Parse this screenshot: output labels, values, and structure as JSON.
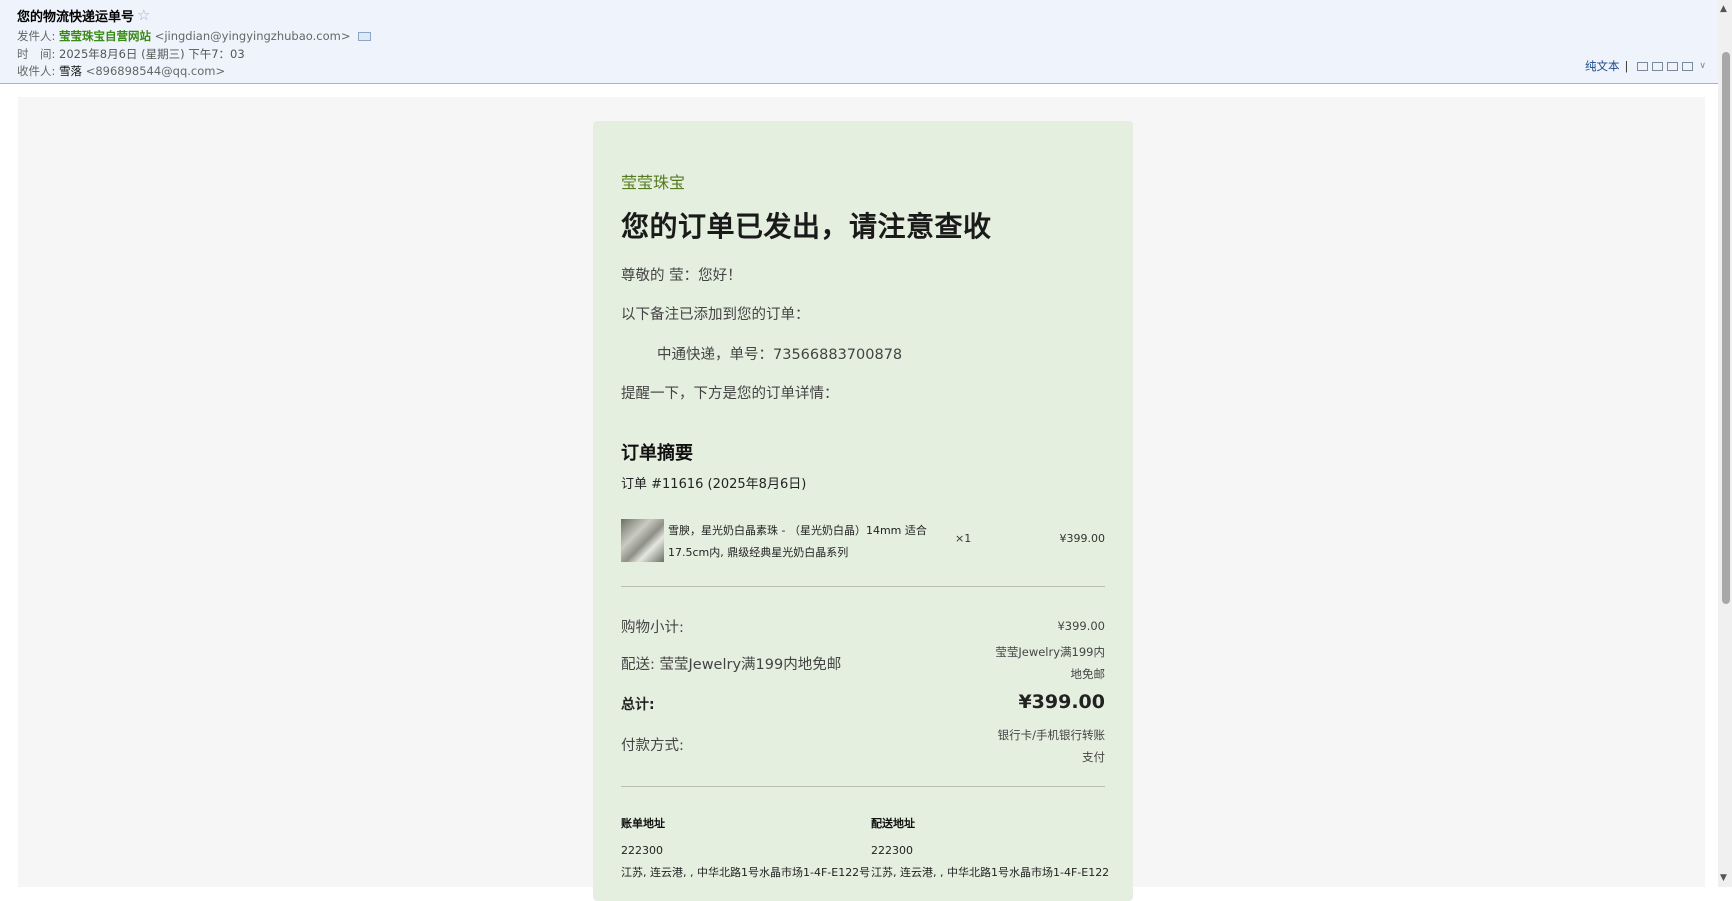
{
  "header": {
    "subject": "您的物流快递运单号",
    "from_label": "发件人:",
    "from_name": "莹莹珠宝自营网站",
    "from_addr": "<jingdian@yingyingzhubao.com>",
    "time_label": "时　间:",
    "time_value": "2025年8月6日 (星期三) 下午7：03",
    "to_label": "收件人:",
    "to_name": "雪落",
    "to_addr": "<896898544@qq.com>",
    "plain_text": "纯文本",
    "separator": "|"
  },
  "email": {
    "brand": "莹莹珠宝",
    "headline": "您的订单已发出，请注意查收",
    "greeting": "尊敬的 莹：您好！",
    "note_intro": "以下备注已添加到您的订单：",
    "tracking": "中通快递，单号：73566883700878",
    "reminder": "提醒一下，下方是您的订单详情：",
    "summary_title": "订单摘要",
    "order_number": "订单 #11616 (2025年8月6日)",
    "items": [
      {
        "name": "雪腴，星光奶白晶素珠 - （星光奶白晶）14mm 适合17.5cm内, 鼎级经典星光奶白晶系列",
        "qty": "×1",
        "price": "¥399.00"
      }
    ],
    "subtotal_label": "购物小计:",
    "subtotal_value": "¥399.00",
    "shipping_label": "配送: 莹莹Jewelry满199内地免邮",
    "shipping_value": "莹莹Jewelry满199内地免邮",
    "total_label": "总计:",
    "total_value": "¥399.00",
    "payment_label": "付款方式:",
    "payment_value": "银行卡/手机银行转账支付",
    "billing_title": "账单地址",
    "billing_zip": "222300",
    "billing_addr": "江苏, 连云港, , 中华北路1号水晶市场1-4F-E122号",
    "shipping_title": "配送地址",
    "shipping_zip": "222300",
    "shipping_addr": "江苏, 连云港, , 中华北路1号水晶市场1-4F-E122"
  },
  "colors": {
    "header_bg": "#eff4fc",
    "sender_green": "#3a8a16",
    "card_bg": "#e5efe0",
    "brand_green": "#557a1e"
  }
}
